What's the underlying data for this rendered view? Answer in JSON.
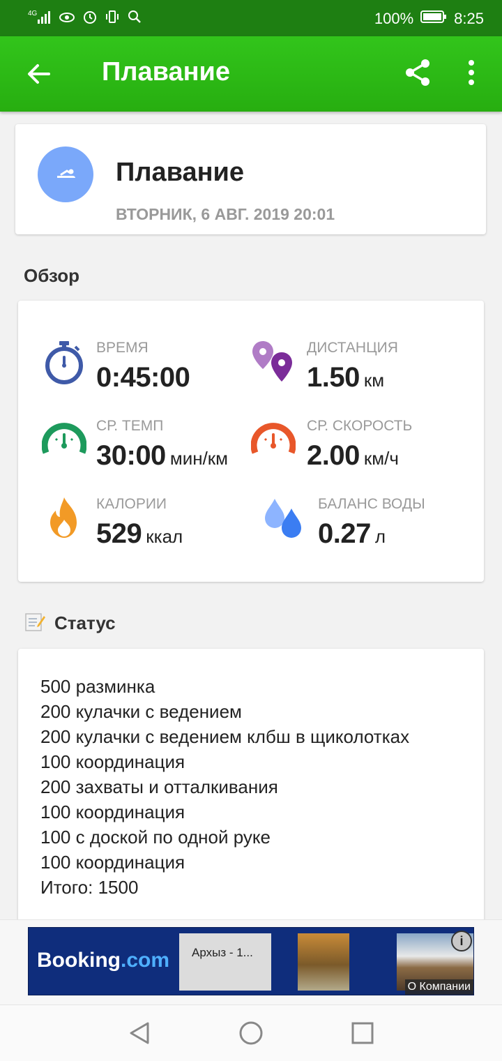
{
  "status_bar": {
    "battery": "100%",
    "time": "8:25",
    "network": "4G"
  },
  "app_bar": {
    "title": "Плавание"
  },
  "activity": {
    "title": "Плавание",
    "datetime": "ВТОРНИК, 6 АВГ. 2019 20:01"
  },
  "overview": {
    "title": "Обзор",
    "stats": [
      {
        "label": "ВРЕМЯ",
        "value": "0:45:00",
        "unit": ""
      },
      {
        "label": "ДИСТАНЦИЯ",
        "value": "1.50",
        "unit": "км"
      },
      {
        "label": "СР. ТЕМП",
        "value": "30:00",
        "unit": "мин/км"
      },
      {
        "label": "СР. СКОРОСТЬ",
        "value": "2.00",
        "unit": "км/ч"
      },
      {
        "label": "КАЛОРИИ",
        "value": "529",
        "unit": "ккал"
      },
      {
        "label": "БАЛАНС ВОДЫ",
        "value": "0.27",
        "unit": "л"
      }
    ]
  },
  "status": {
    "title": "Статус",
    "lines": [
      "500 разминка",
      "200 кулачки с ведением",
      "200 кулачки с ведением клбш в щиколотках",
      "100 координация",
      "200 захваты и отталкивания",
      "100 координация",
      "100 с доской по одной руке",
      "100 координация",
      "Итого: 1500"
    ]
  },
  "ad": {
    "brand": "Booking",
    "brand_suffix": ".com",
    "tile_text": "Архыз - 1...",
    "company_label": "О Компании"
  },
  "colors": {
    "app_bar": "#2db716",
    "status_bar": "#1e7f12",
    "accent_blue": "#3f5aa8"
  }
}
